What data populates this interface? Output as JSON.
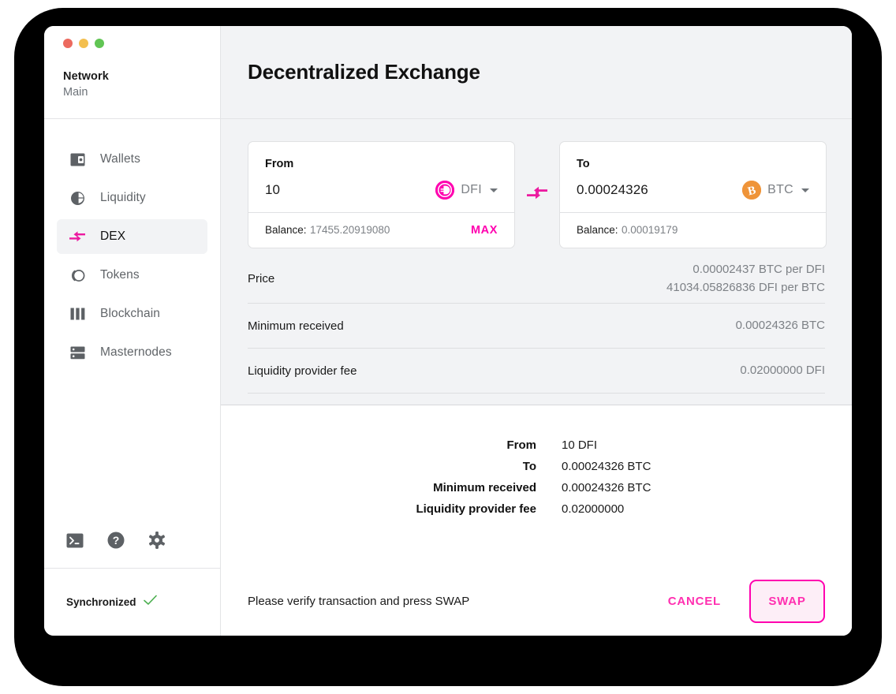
{
  "window": {
    "traffic_lights": [
      "close",
      "minimize",
      "maximize"
    ]
  },
  "sidebar": {
    "network_label": "Network",
    "network_value": "Main",
    "items": [
      {
        "label": "Wallets",
        "icon": "wallet-icon",
        "active": false
      },
      {
        "label": "Liquidity",
        "icon": "pie-chart-icon",
        "active": false
      },
      {
        "label": "DEX",
        "icon": "swap-arrows-icon",
        "active": true
      },
      {
        "label": "Tokens",
        "icon": "tokens-icon",
        "active": false
      },
      {
        "label": "Blockchain",
        "icon": "bars-icon",
        "active": false
      },
      {
        "label": "Masternodes",
        "icon": "server-icon",
        "active": false
      }
    ],
    "tools": [
      {
        "name": "console-icon"
      },
      {
        "name": "help-icon"
      },
      {
        "name": "gear-icon"
      }
    ],
    "status": {
      "text": "Synchronized",
      "check_icon": "check-icon",
      "check_color": "#4caf50"
    }
  },
  "header": {
    "title": "Decentralized Exchange"
  },
  "dex": {
    "from": {
      "label": "From",
      "amount": "10",
      "placeholder": "0",
      "token": "DFI",
      "token_color": "#ff00af",
      "balance_label": "Balance:",
      "balance_value": "17455.20919080",
      "max_label": "MAX"
    },
    "to": {
      "label": "To",
      "amount": "0.00024326",
      "placeholder": "0",
      "token": "BTC",
      "token_color": "#ef9439",
      "balance_label": "Balance:",
      "balance_value": "0.00019179"
    },
    "swap_direction_icon": "swap-arrows-icon",
    "info_rows": [
      {
        "label": "Price",
        "value_lines": [
          "0.00002437 BTC per DFI",
          "41034.05826836 DFI per BTC"
        ]
      },
      {
        "label": "Minimum received",
        "value_lines": [
          "0.00024326 BTC"
        ]
      },
      {
        "label": "Liquidity provider fee",
        "value_lines": [
          "0.02000000 DFI"
        ]
      }
    ]
  },
  "summary": {
    "rows": [
      {
        "key": "From",
        "value": "10 DFI"
      },
      {
        "key": "To",
        "value": "0.00024326 BTC"
      },
      {
        "key": "Minimum received",
        "value": "0.00024326 BTC"
      },
      {
        "key": "Liquidity provider fee",
        "value": "0.02000000"
      }
    ]
  },
  "action_bar": {
    "message": "Please verify transaction and press SWAP",
    "cancel_label": "CANCEL",
    "swap_label": "SWAP",
    "accent_color": "#ff00af"
  }
}
